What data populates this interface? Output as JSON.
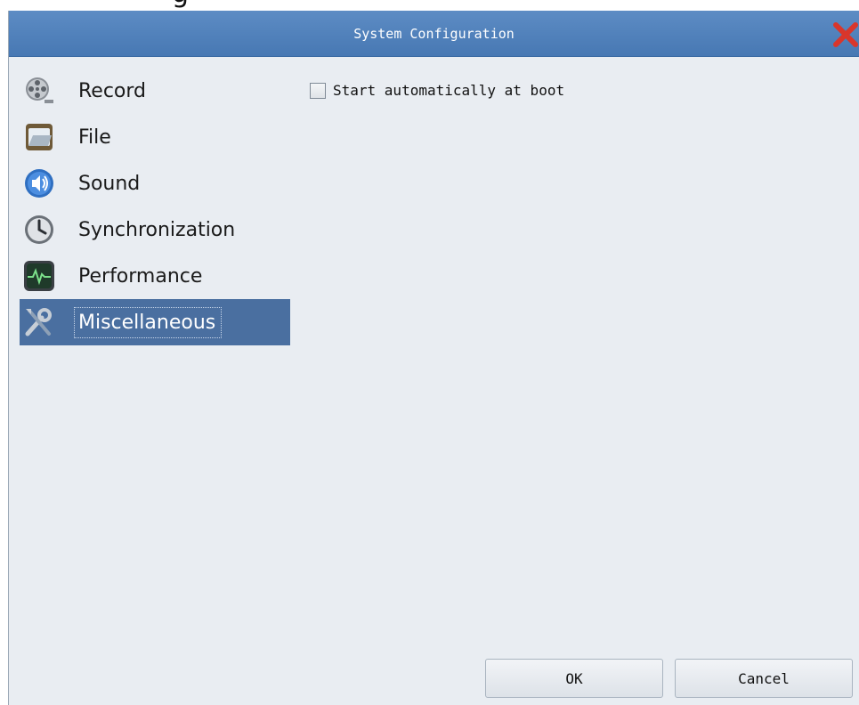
{
  "dialog": {
    "title": "System Configuration",
    "close_icon": "close-x-icon",
    "accent_color": "#4a6fa0",
    "close_color": "#d9362b"
  },
  "sidebar": {
    "items": [
      {
        "label": "Record",
        "icon": "film-reel-icon",
        "selected": false
      },
      {
        "label": "File",
        "icon": "folder-icon",
        "selected": false
      },
      {
        "label": "Sound",
        "icon": "speaker-icon",
        "selected": false
      },
      {
        "label": "Synchronization",
        "icon": "clock-icon",
        "selected": false
      },
      {
        "label": "Performance",
        "icon": "pulse-monitor-icon",
        "selected": false
      },
      {
        "label": "Miscellaneous",
        "icon": "tools-icon",
        "selected": true
      }
    ]
  },
  "content": {
    "autostart_label": "Start automatically at boot",
    "autostart_checked": false
  },
  "buttons": {
    "ok_label": "OK",
    "cancel_label": "Cancel"
  }
}
